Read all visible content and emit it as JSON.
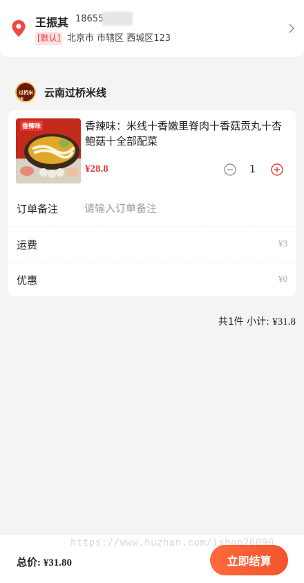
{
  "address": {
    "name": "王振其",
    "phone": "18655",
    "tag": "[默认]",
    "detail": "北京市 市辖区 西城区123"
  },
  "shop": {
    "logo_text": "过桥米线",
    "name": "云南过桥米线"
  },
  "product": {
    "image_text": "香辣味",
    "title": "香辣味：米线十香嫩里脊肉十香菇贡丸十杏鲍菇十全部配菜",
    "price": "¥28.8",
    "quantity": "1"
  },
  "rows": {
    "note_label": "订单备注",
    "note_placeholder": "请输入订单备注",
    "shipping_label": "运费",
    "shipping_value": "¥3",
    "discount_label": "优惠",
    "discount_value": "¥0"
  },
  "summary": {
    "text_prefix": "共1件 小计: ",
    "amount": "¥31.8"
  },
  "footer": {
    "watermark": "https://www.huzhan.com/ishop26090",
    "total": "总价: ¥31.80",
    "checkout_label": "立即结算"
  },
  "colors": {
    "accent": "#e33b3b",
    "button": "#f2542d"
  }
}
